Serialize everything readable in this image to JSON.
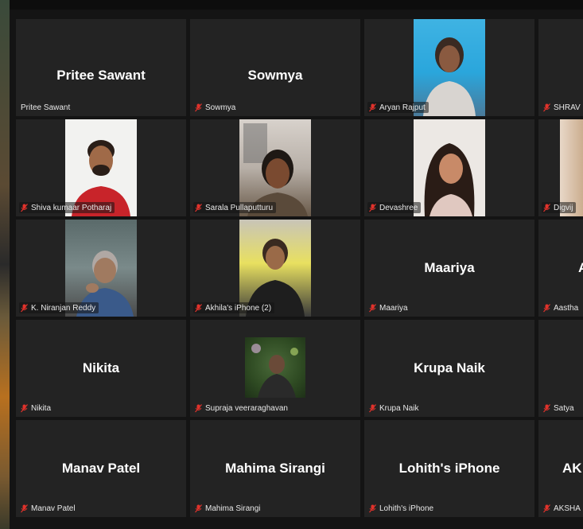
{
  "participants": [
    {
      "display": "Pritee Sawant",
      "label": "Pritee Sawant",
      "video": false,
      "muted": false
    },
    {
      "display": "Sowmya",
      "label": "Sowmya",
      "video": false,
      "muted": true
    },
    {
      "display": "",
      "label": "Aryan Rajput",
      "video": true,
      "muted": true
    },
    {
      "display": "",
      "label": "SHRAV",
      "video": false,
      "muted": true
    },
    {
      "display": "",
      "label": "Shiva kumaar Potharaj",
      "video": true,
      "muted": true
    },
    {
      "display": "",
      "label": "Sarala Pullaputturu",
      "video": true,
      "muted": true
    },
    {
      "display": "",
      "label": "Devashree",
      "video": true,
      "muted": true
    },
    {
      "display": "",
      "label": "Digvij",
      "video": true,
      "muted": true
    },
    {
      "display": "",
      "label": "K. Niranjan Reddy",
      "video": true,
      "muted": true
    },
    {
      "display": "",
      "label": "Akhila's iPhone (2)",
      "video": true,
      "muted": true
    },
    {
      "display": "Maariya",
      "label": "Maariya",
      "video": false,
      "muted": true
    },
    {
      "display": "A",
      "label": "Aastha",
      "video": false,
      "muted": true
    },
    {
      "display": "Nikita",
      "label": "Nikita",
      "video": false,
      "muted": true
    },
    {
      "display": "",
      "label": "Supraja veeraraghavan",
      "video": true,
      "muted": true
    },
    {
      "display": "Krupa Naik",
      "label": "Krupa Naik",
      "video": false,
      "muted": true
    },
    {
      "display": "",
      "label": "Satya",
      "video": false,
      "muted": true
    },
    {
      "display": "Manav Patel",
      "label": "Manav Patel",
      "video": false,
      "muted": true
    },
    {
      "display": "Mahima Sirangi",
      "label": "Mahima Sirangi",
      "video": false,
      "muted": true
    },
    {
      "display": "Lohith's iPhone",
      "label": "Lohith's iPhone",
      "video": false,
      "muted": true
    },
    {
      "display": "AK",
      "label": "AKSHA",
      "video": false,
      "muted": true
    }
  ],
  "colors": {
    "tile": "#232323",
    "muted_icon": "#e0322b",
    "text": "#ffffff"
  }
}
